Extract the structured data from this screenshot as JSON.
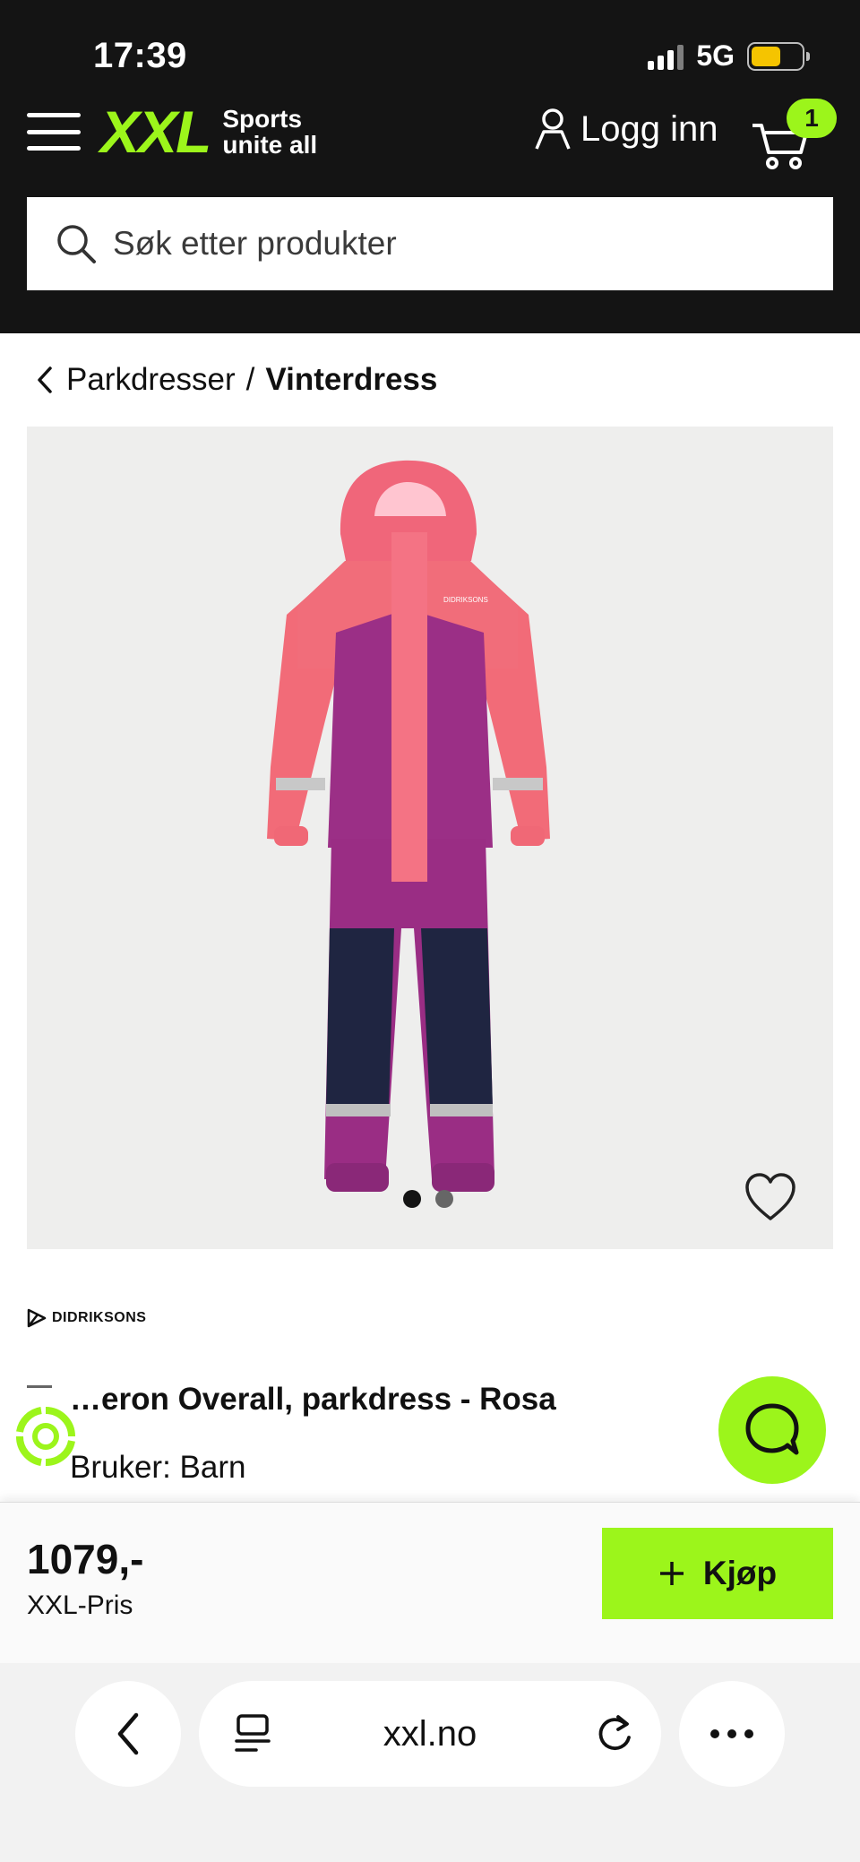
{
  "status": {
    "time": "17:39",
    "network": "5G"
  },
  "header": {
    "logo": "XXL",
    "tagline_1": "Sports",
    "tagline_2": "unite all",
    "login_label": "Logg inn",
    "cart_count": "1"
  },
  "search": {
    "placeholder": "Søk etter produkter"
  },
  "breadcrumb": {
    "parent": "Parkdresser",
    "separator": "/",
    "current": "Vinterdress"
  },
  "gallery": {
    "slide_count": 2,
    "active_slide": 1
  },
  "product": {
    "brand": "DIDRIKSONS",
    "title": "…eron Overall, parkdress - Rosa",
    "user_line": "Bruker: Barn"
  },
  "purchase": {
    "price": "1079,-",
    "price_label": "XXL-Pris",
    "buy_label": "Kjøp"
  },
  "browser": {
    "url": "xxl.no"
  },
  "colors": {
    "accent": "#9cf51b",
    "header_bg": "#141414",
    "gallery_bg": "#eeeeed"
  }
}
